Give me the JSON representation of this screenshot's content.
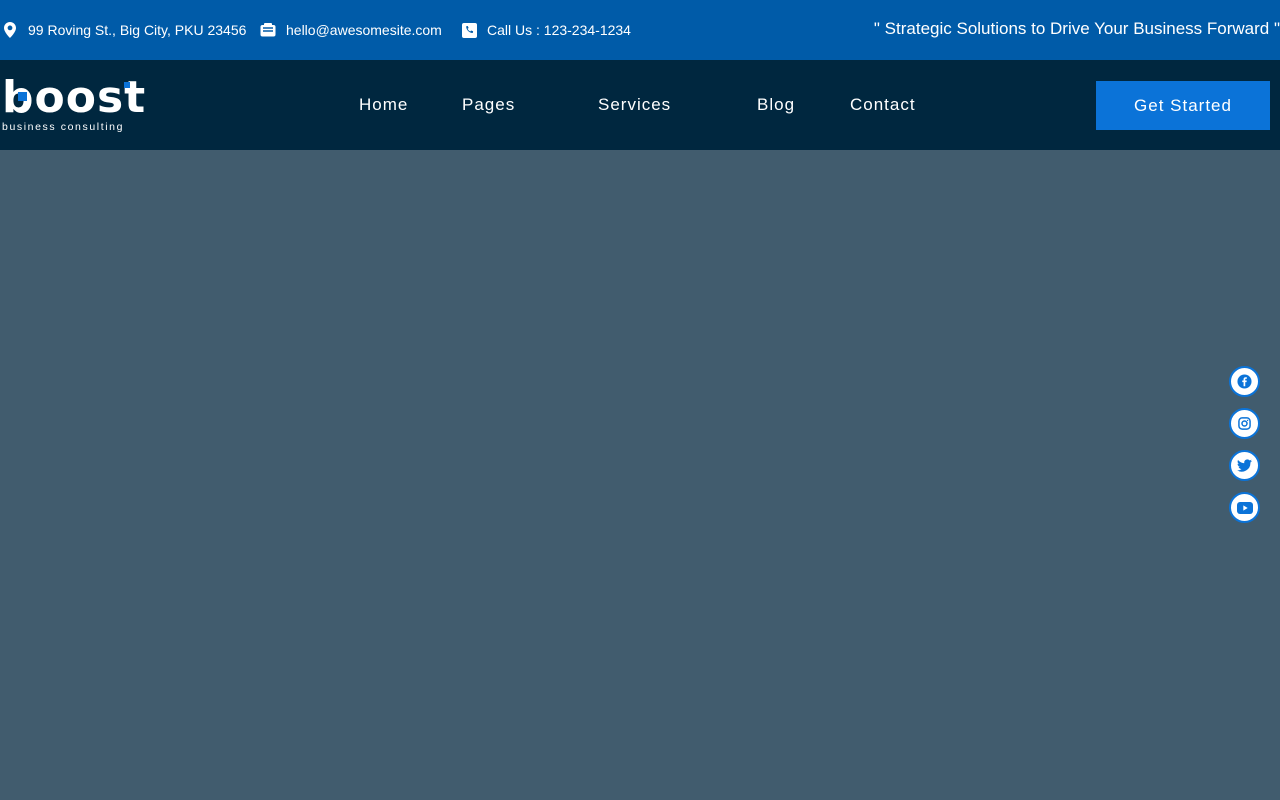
{
  "topbar": {
    "address": "99 Roving St., Big City, PKU 23456",
    "email": "hello@awesomesite.com",
    "phone": "Call Us : 123-234-1234",
    "tagline": "\" Strategic Solutions to Drive Your Business Forward \""
  },
  "logo": {
    "word": "boost",
    "subtitle": "business consulting"
  },
  "nav": {
    "items": [
      {
        "label": "Home"
      },
      {
        "label": "Pages"
      },
      {
        "label": "Services"
      },
      {
        "label": "Blog"
      },
      {
        "label": "Contact"
      }
    ],
    "cta_label": "Get Started"
  },
  "social": {
    "icons": [
      "facebook-icon",
      "instagram-icon",
      "twitter-icon",
      "youtube-icon"
    ]
  },
  "colors": {
    "topbar": "#005ba8",
    "navbar": "#00273f",
    "accent": "#0b73d8",
    "hero_bg": "#415c6e"
  }
}
